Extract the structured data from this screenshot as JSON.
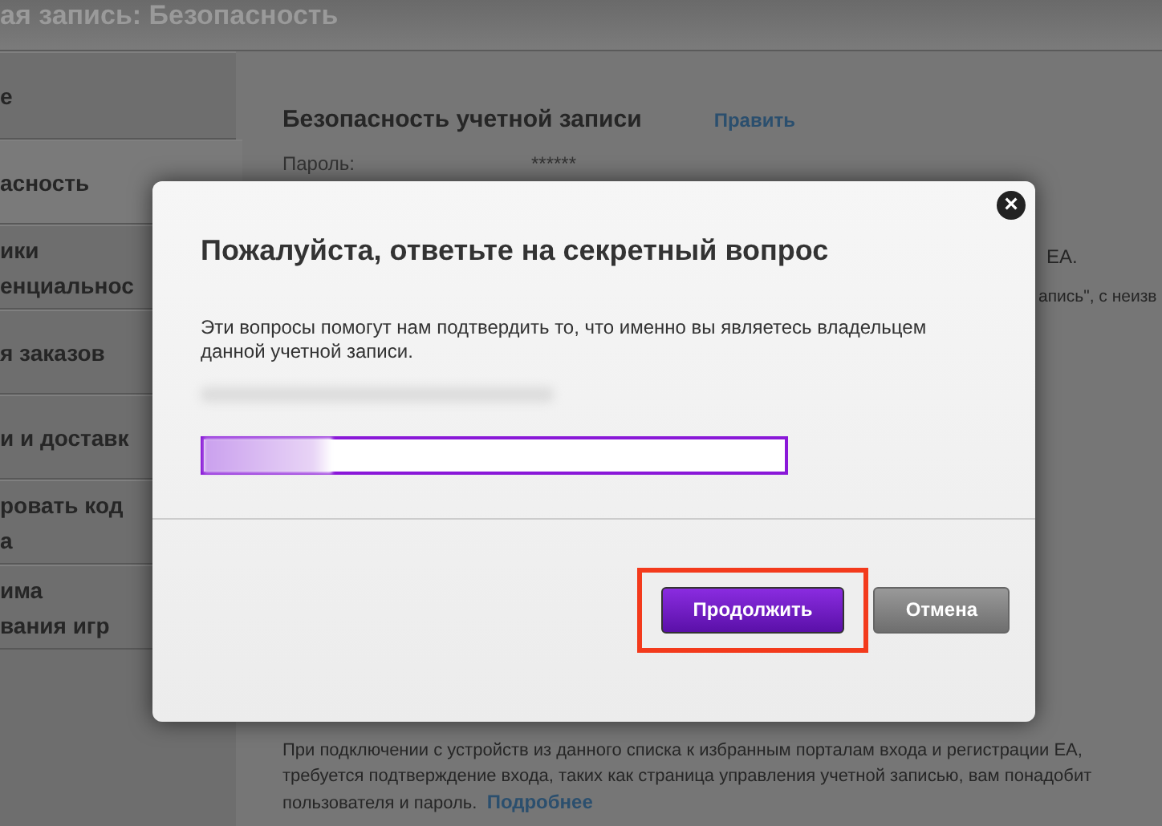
{
  "header": {
    "title": "ая запись: Безопасность"
  },
  "sidebar": {
    "items": [
      {
        "label": "е",
        "selected": false
      },
      {
        "label": "асность",
        "selected": true
      },
      {
        "label": "ики\nенциальнос",
        "selected": false
      },
      {
        "label": "я заказов",
        "selected": false
      },
      {
        "label": "и и доставк",
        "selected": false
      },
      {
        "label": "ровать код\nа",
        "selected": false
      },
      {
        "label": "има\nвания игр",
        "selected": false
      }
    ]
  },
  "content": {
    "section_title": "Безопасность учетной записи",
    "edit_link": "Править",
    "password_label": "Пароль:",
    "password_value": "******",
    "fragments": [
      "EA.",
      "апись\", с неизв"
    ],
    "paragraph": "При подключении с устройств из данного списка к избранным порталам входа и регистрации EA,\nтребуется подтверждение входа, таких как страница управления учетной записью, вам понадобит\nпользователя и пароль.",
    "more_link": "Подробнее"
  },
  "dialog": {
    "title": "Пожалуйста, ответьте на секретный вопрос",
    "description": "Эти вопросы помогут нам подтвердить то, что именно вы являетесь владельцем данной учетной записи.",
    "close": "×",
    "buttons": [
      {
        "label": "Продолжить",
        "kind": "primary",
        "highlighted": true
      },
      {
        "label": "Отмена",
        "kind": "secondary",
        "highlighted": false
      }
    ]
  }
}
